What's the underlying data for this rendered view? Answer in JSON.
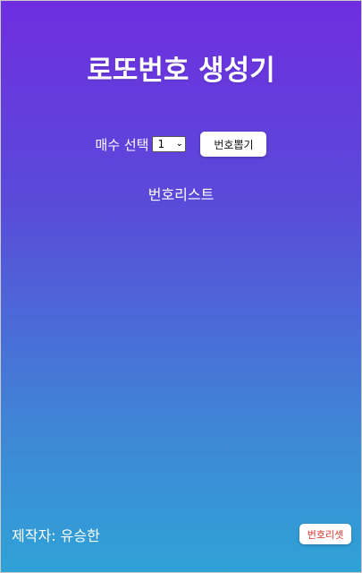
{
  "app": {
    "title": "로또번호 생성기"
  },
  "controls": {
    "count_label": "매수 선택",
    "count_selected": "1",
    "draw_button_label": "번호뽑기"
  },
  "list": {
    "title": "번호리스트"
  },
  "footer": {
    "author": "제작자: 유승한",
    "reset_button_label": "번호리셋"
  },
  "colors": {
    "gradient_top": "#6f2ee0",
    "gradient_bottom": "#2fa2d6",
    "reset_text": "#e0332a"
  }
}
